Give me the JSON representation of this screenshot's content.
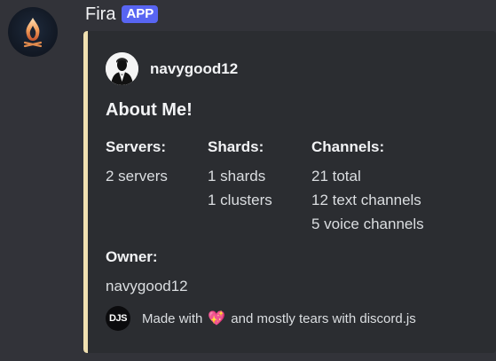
{
  "message": {
    "bot_name": "Fira",
    "app_tag": "APP",
    "avatar_icon": "flame-logo-icon"
  },
  "embed": {
    "accent_color": "#f0e0b0",
    "author": {
      "name": "navygood12",
      "avatar_icon": "tuxedo-avatar-icon"
    },
    "title": "About Me!",
    "fields": {
      "servers": {
        "name": "Servers:",
        "values": [
          "2 servers"
        ]
      },
      "shards": {
        "name": "Shards:",
        "values": [
          "1 shards",
          "1 clusters"
        ]
      },
      "channels": {
        "name": "Channels:",
        "values": [
          "21 total",
          "12 text channels",
          "5 voice channels"
        ]
      },
      "owner": {
        "name": "Owner:",
        "values": [
          "navygood12"
        ]
      }
    },
    "footer": {
      "icon_label": "DJS",
      "text_before": "Made with",
      "heart": "💖",
      "text_after": "and mostly tears with discord.js"
    }
  }
}
